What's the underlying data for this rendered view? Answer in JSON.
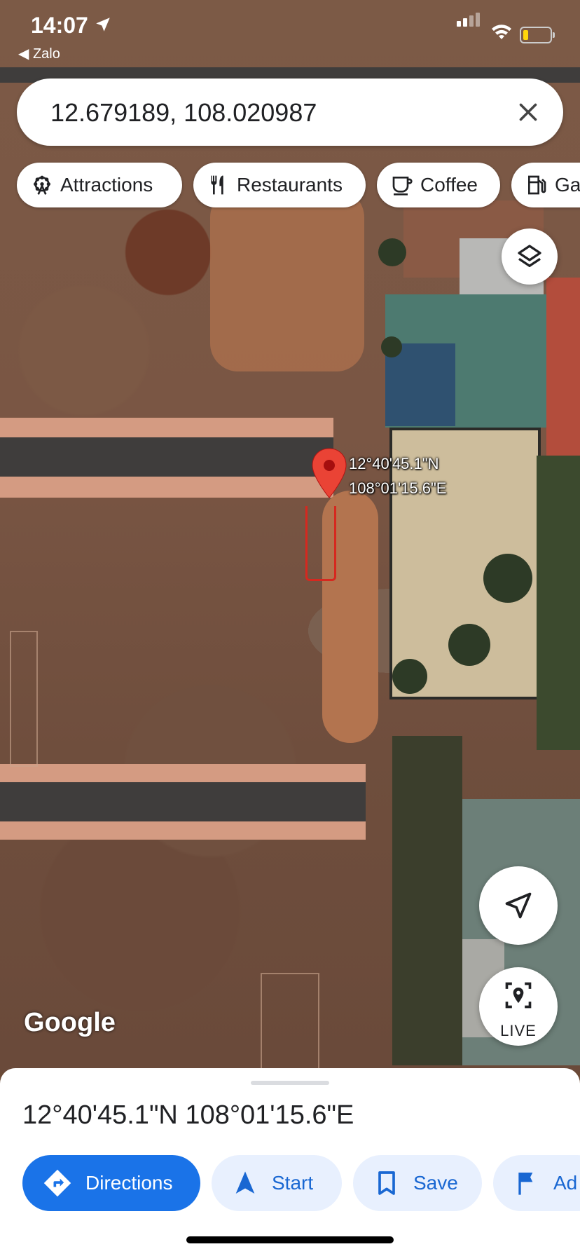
{
  "status_bar": {
    "time": "14:07",
    "back_app": "◀ Zalo"
  },
  "search": {
    "query": "12.679189, 108.020987"
  },
  "chips": [
    {
      "label": "Attractions",
      "icon": "ferris-wheel-icon"
    },
    {
      "label": "Restaurants",
      "icon": "fork-knife-icon"
    },
    {
      "label": "Coffee",
      "icon": "coffee-cup-icon"
    },
    {
      "label": "Ga",
      "icon": "gas-pump-icon"
    }
  ],
  "map": {
    "pin_label_lat": "12°40'45.1\"N",
    "pin_label_lng": "108°01'15.6\"E",
    "attribution": "Google",
    "live_label": "LIVE"
  },
  "sheet": {
    "title": "12°40'45.1\"N 108°01'15.6\"E",
    "actions": [
      {
        "label": "Directions",
        "icon": "directions-icon",
        "style": "primary"
      },
      {
        "label": "Start",
        "icon": "navigation-arrow-icon",
        "style": "secondary"
      },
      {
        "label": "Save",
        "icon": "bookmark-icon",
        "style": "secondary"
      },
      {
        "label": "Ad",
        "icon": "flag-icon",
        "style": "secondary"
      }
    ]
  },
  "colors": {
    "accent": "#1a73e8",
    "accent_light": "#e8f0fe",
    "pin": "#ea4335"
  }
}
